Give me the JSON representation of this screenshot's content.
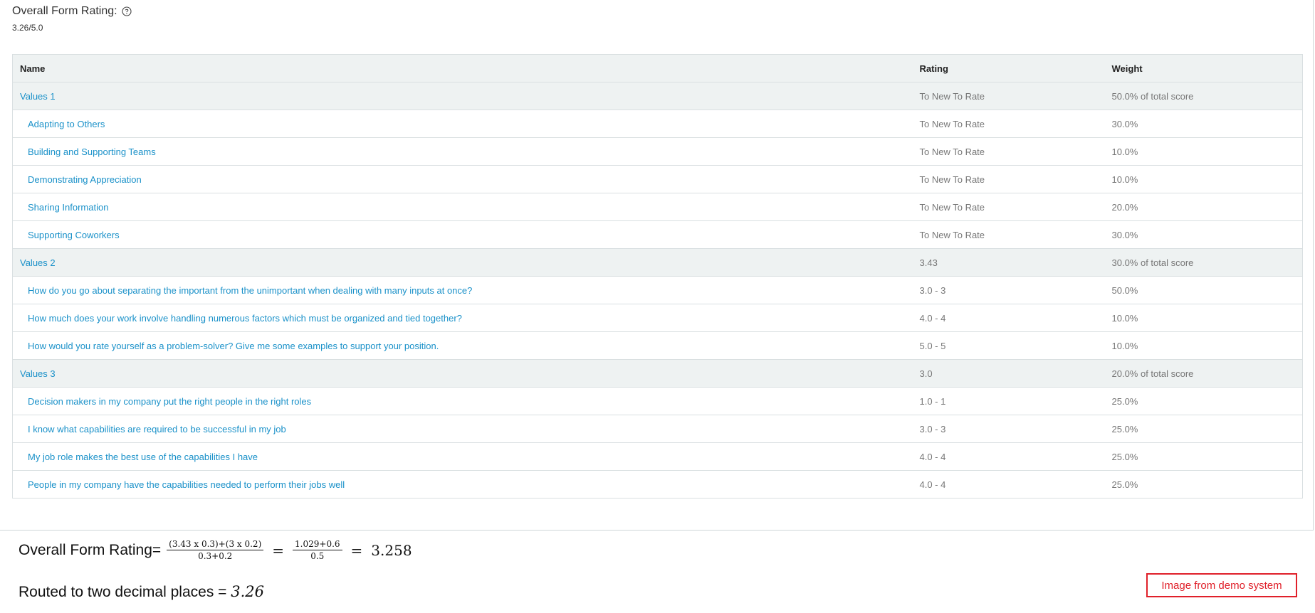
{
  "header": {
    "title": "Overall Form Rating:",
    "value": "3.26/5.0"
  },
  "table": {
    "columns": [
      "Name",
      "Rating",
      "Weight"
    ],
    "rows": [
      {
        "type": "group",
        "name": "Values 1",
        "rating": "To New To Rate",
        "weight": "50.0% of total score"
      },
      {
        "type": "item",
        "name": "Adapting to Others",
        "rating": "To New To Rate",
        "weight": "30.0%"
      },
      {
        "type": "item",
        "name": "Building and Supporting Teams",
        "rating": "To New To Rate",
        "weight": "10.0%"
      },
      {
        "type": "item",
        "name": "Demonstrating Appreciation",
        "rating": "To New To Rate",
        "weight": "10.0%"
      },
      {
        "type": "item",
        "name": "Sharing Information",
        "rating": "To New To Rate",
        "weight": "20.0%"
      },
      {
        "type": "item",
        "name": "Supporting Coworkers",
        "rating": "To New To Rate",
        "weight": "30.0%"
      },
      {
        "type": "group",
        "name": "Values 2",
        "rating": "3.43",
        "weight": "30.0% of total score"
      },
      {
        "type": "item",
        "name": "How do you go about separating the important from the unimportant when dealing with many inputs at once?",
        "rating": "3.0 - 3",
        "weight": "50.0%"
      },
      {
        "type": "item",
        "name": "How much does your work involve handling numerous factors which must be organized and tied together?",
        "rating": "4.0 - 4",
        "weight": "10.0%"
      },
      {
        "type": "item",
        "name": "How would you rate yourself as a problem-solver? Give me some examples to support your position.",
        "rating": "5.0 - 5",
        "weight": "10.0%"
      },
      {
        "type": "group",
        "name": "Values 3",
        "rating": "3.0",
        "weight": "20.0% of total score"
      },
      {
        "type": "item",
        "name": "Decision makers in my company put the right people in the right roles",
        "rating": "1.0 - 1",
        "weight": "25.0%"
      },
      {
        "type": "item",
        "name": "I know what capabilities are required to be successful in my job",
        "rating": "3.0 - 3",
        "weight": "25.0%"
      },
      {
        "type": "item",
        "name": "My job role makes the best use of the capabilities I have",
        "rating": "4.0 - 4",
        "weight": "25.0%"
      },
      {
        "type": "item",
        "name": "People in my company have the capabilities needed to perform their jobs well",
        "rating": "4.0 - 4",
        "weight": "25.0%"
      }
    ]
  },
  "formula": {
    "label": "Overall Form Rating=",
    "frac1_num": "(3.43 x 0.3)+(3 x 0.2)",
    "frac1_den": "0.3+0.2",
    "eq1": "=",
    "frac2_num": "1.029+0.6",
    "frac2_den": "0.5",
    "eq2": "=",
    "result": "3.258"
  },
  "rounded": {
    "label": "Routed to two decimal places = ",
    "value": "3.26"
  },
  "badge": "Image from demo system",
  "colors": {
    "link": "#1a91c9",
    "group_row_bg": "#eef2f2",
    "badge": "#e0202a"
  },
  "icons": {
    "help": "question-circle-icon"
  }
}
